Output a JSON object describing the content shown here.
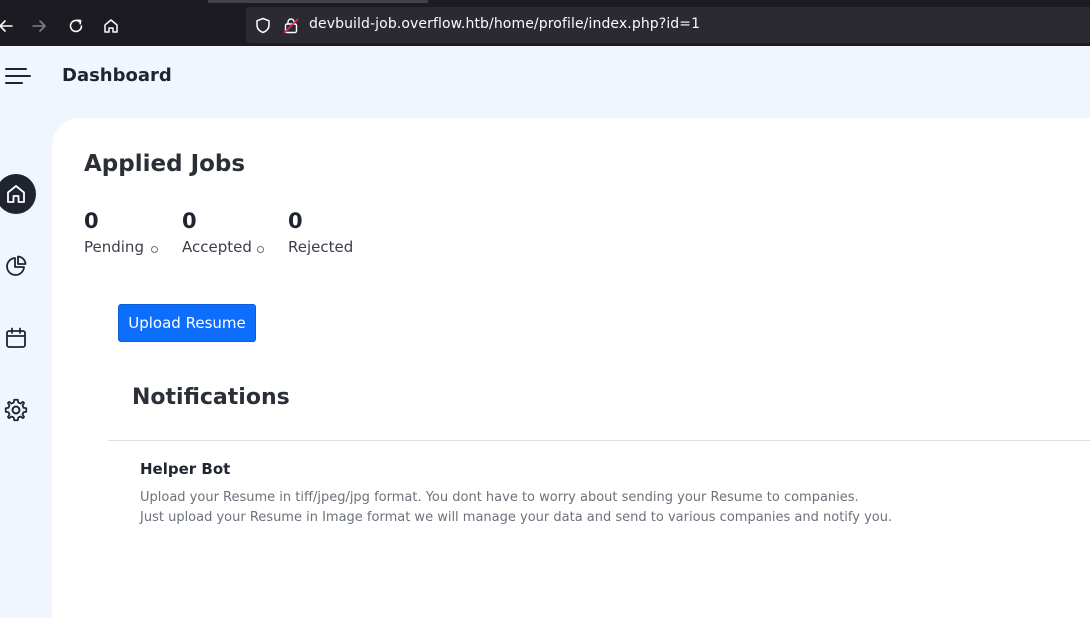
{
  "browser": {
    "url": "devbuild-job.overflow.htb/home/profile/index.php?id=1"
  },
  "header": {
    "title": "Dashboard"
  },
  "sidebar": {
    "items": [
      {
        "name": "home",
        "icon": "home-icon",
        "active": true
      },
      {
        "name": "stats",
        "icon": "pie-chart-icon",
        "active": false
      },
      {
        "name": "calendar",
        "icon": "calendar-icon",
        "active": false
      },
      {
        "name": "settings",
        "icon": "gear-icon",
        "active": false
      }
    ]
  },
  "applied_jobs": {
    "title": "Applied Jobs",
    "stats": [
      {
        "value": "0",
        "label": "Pending"
      },
      {
        "value": "0",
        "label": "Accepted"
      },
      {
        "value": "0",
        "label": "Rejected"
      }
    ]
  },
  "upload": {
    "label": "Upload Resume"
  },
  "notifications": {
    "title": "Notifications",
    "items": [
      {
        "sender": "Helper Bot",
        "lines": [
          "Upload your Resume in tiff/jpeg/jpg format. You dont have to worry about sending your Resume to companies.",
          "Just upload your Resume in Image format we will manage your data and send to various companies and notify you."
        ]
      }
    ]
  },
  "colors": {
    "accent": "#0d6efd",
    "page_background": "#f1f6fe",
    "chrome_background": "#1c1b22"
  }
}
